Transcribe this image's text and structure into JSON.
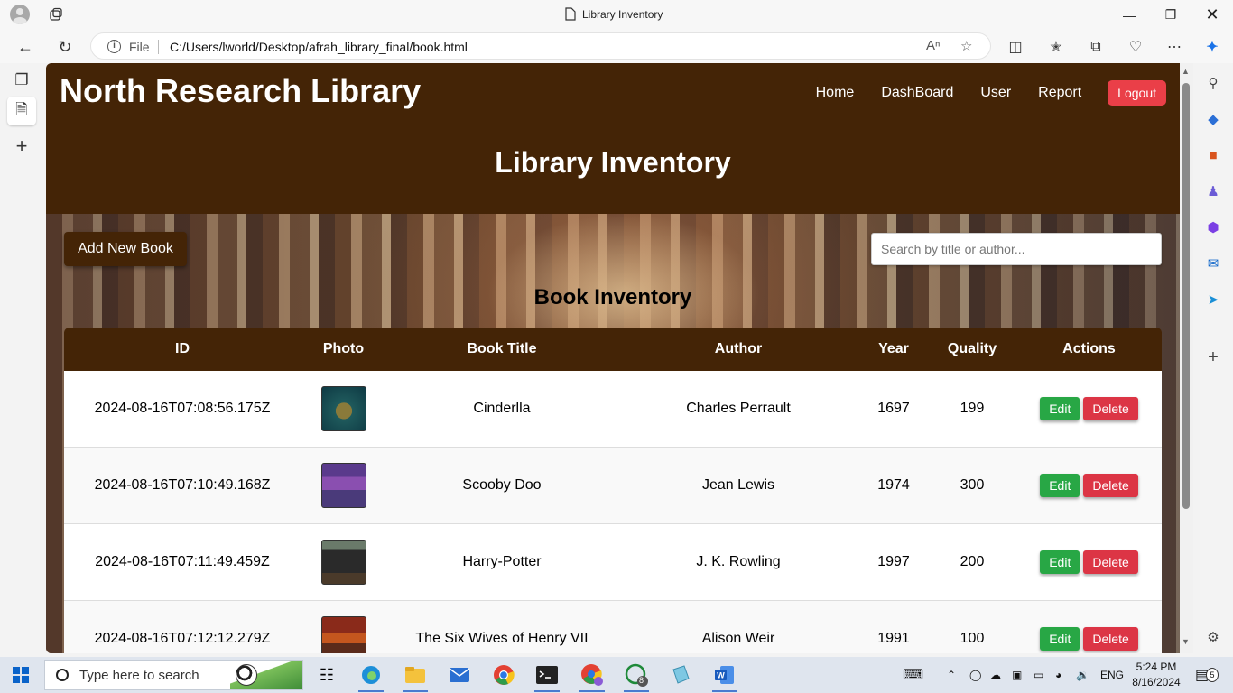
{
  "browser": {
    "tab_title": "Library Inventory",
    "address_prefix": "File",
    "url": "C:/Users/lworld/Desktop/afrah_library_final/book.html"
  },
  "header": {
    "brand": "North Research Library",
    "nav": [
      "Home",
      "DashBoard",
      "User",
      "Report"
    ],
    "logout": "Logout",
    "page_title": "Library Inventory"
  },
  "toolbar": {
    "add_button": "Add New Book",
    "search_placeholder": "Search by title or author...",
    "section_title": "Book Inventory"
  },
  "table": {
    "headers": [
      "ID",
      "Photo",
      "Book Title",
      "Author",
      "Year",
      "Quality",
      "Actions"
    ],
    "rows": [
      {
        "id": "2024-08-16T07:08:56.175Z",
        "title": "Cinderlla",
        "author": "Charles Perrault",
        "year": "1697",
        "quality": "199"
      },
      {
        "id": "2024-08-16T07:10:49.168Z",
        "title": "Scooby Doo",
        "author": "Jean Lewis",
        "year": "1974",
        "quality": "300"
      },
      {
        "id": "2024-08-16T07:11:49.459Z",
        "title": "Harry-Potter",
        "author": "J. K. Rowling",
        "year": "1997",
        "quality": "200"
      },
      {
        "id": "2024-08-16T07:12:12.279Z",
        "title": "The Six Wives of Henry VII",
        "author": "Alison Weir",
        "year": "1991",
        "quality": "100"
      }
    ],
    "edit_label": "Edit",
    "delete_label": "Delete"
  },
  "taskbar": {
    "search_placeholder": "Type here to search",
    "language": "ENG",
    "time": "5:24 PM",
    "date": "8/16/2024",
    "whatsapp_badge": "8",
    "notification_badge": "5"
  },
  "colors": {
    "brand_brown": "#442406",
    "logout_red": "#ea3f48",
    "edit_green": "#28a745",
    "delete_red": "#dc3545"
  }
}
